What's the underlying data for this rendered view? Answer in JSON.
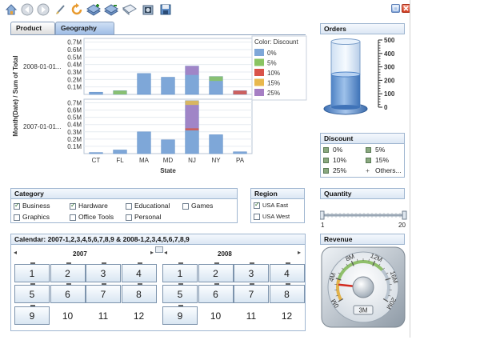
{
  "toolbar": {
    "icons": [
      "home-icon",
      "back-icon",
      "forward-icon",
      "clear-icon",
      "refresh-icon",
      "bookmark-add-icon",
      "bookmark-remove-icon",
      "email-icon",
      "print-icon",
      "save-icon"
    ]
  },
  "tabs": [
    {
      "label": "Product",
      "selected": false
    },
    {
      "label": "Geography",
      "selected": true
    }
  ],
  "chart": {
    "color_legend_title": "Color: Discount",
    "color_legend": [
      {
        "label": "0%",
        "color": "#7ea7d8"
      },
      {
        "label": "5%",
        "color": "#8ac462"
      },
      {
        "label": "10%",
        "color": "#d9534a"
      },
      {
        "label": "15%",
        "color": "#e8b84e"
      },
      {
        "label": "25%",
        "color": "#a67fc4"
      }
    ]
  },
  "chart_data": {
    "type": "bar",
    "title": "",
    "xlabel": "State",
    "ylabel": "Month(Date) / Sum of Total",
    "categories": [
      "CT",
      "FL",
      "MA",
      "MD",
      "NJ",
      "NY",
      "PA"
    ],
    "yticks": [
      "0.1M",
      "0.2M",
      "0.3M",
      "0.4M",
      "0.5M",
      "0.6M",
      "0.7M"
    ],
    "ylim": [
      0,
      750000
    ],
    "panels": [
      {
        "row_label": "2008-01-01...",
        "values": [
          30000,
          50000,
          280000,
          230000,
          380000,
          240000,
          50000
        ],
        "discount_segments": [
          {
            "state": "FL",
            "color": "#8ac462",
            "value": 50000
          },
          {
            "state": "NJ",
            "color": "#a67fc4",
            "value": 120000
          },
          {
            "state": "NY",
            "color": "#8ac462",
            "value": 60000
          },
          {
            "state": "PA",
            "color": "#d9534a",
            "value": 50000
          }
        ]
      },
      {
        "row_label": "2007-01-01...",
        "values": [
          15000,
          50000,
          300000,
          190000,
          730000,
          260000,
          25000
        ],
        "discount_segments": [
          {
            "state": "NJ",
            "color": "#e8b84e",
            "value": 60000
          },
          {
            "state": "NJ",
            "color": "#a67fc4",
            "value": 320000
          },
          {
            "state": "NJ",
            "color": "#d9534a",
            "value": 30000
          }
        ]
      }
    ]
  },
  "orders": {
    "title": "Orders",
    "scale": [
      "500",
      "400",
      "300",
      "200",
      "100",
      "0"
    ],
    "level": 0.5
  },
  "discount": {
    "title": "Discount",
    "items": [
      "0%",
      "5%",
      "10%",
      "15%",
      "25%",
      "Others..."
    ]
  },
  "category": {
    "title": "Category",
    "items": [
      {
        "label": "Business",
        "checked": true
      },
      {
        "label": "Hardware",
        "checked": true
      },
      {
        "label": "Educational",
        "checked": false
      },
      {
        "label": "Games",
        "checked": false
      },
      {
        "label": "Graphics",
        "checked": false
      },
      {
        "label": "Office Tools",
        "checked": false
      },
      {
        "label": "Personal",
        "checked": false
      }
    ]
  },
  "region": {
    "title": "Region",
    "items": [
      {
        "label": "USA East",
        "checked": true
      },
      {
        "label": "USA West",
        "checked": false
      }
    ]
  },
  "quantity": {
    "title": "Quantity",
    "min": "1",
    "max": "20"
  },
  "calendar": {
    "title": "Calendar: 2007-1,2,3,4,5,6,7,8,9 & 2008-1,2,3,4,5,6,7,8,9",
    "years": [
      {
        "year": "2007",
        "months": [
          "1",
          "2",
          "3",
          "4",
          "5",
          "6",
          "7",
          "8",
          "9",
          "10",
          "11",
          "12"
        ],
        "selected": [
          1,
          2,
          3,
          4,
          5,
          6,
          7,
          8,
          9
        ]
      },
      {
        "year": "2008",
        "months": [
          "1",
          "2",
          "3",
          "4",
          "5",
          "6",
          "7",
          "8",
          "9",
          "10",
          "11",
          "12"
        ],
        "selected": [
          1,
          2,
          3,
          4,
          5,
          6,
          7,
          8,
          9
        ]
      }
    ]
  },
  "revenue": {
    "title": "Revenue",
    "dial_labels": [
      "0M",
      "4M",
      "8M",
      "12M",
      "16M",
      "20M"
    ],
    "value_label": "3M",
    "value": 3
  }
}
